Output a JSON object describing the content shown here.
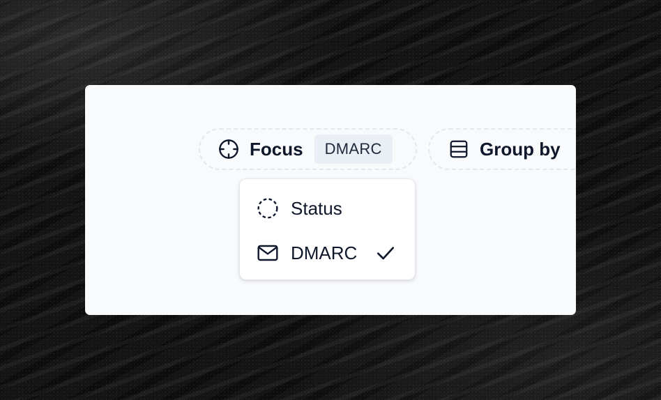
{
  "toolbar": {
    "focus": {
      "label": "Focus",
      "icon": "crosshair-icon",
      "selected_value": "DMARC"
    },
    "group_by": {
      "label": "Group by",
      "icon": "rows-icon"
    }
  },
  "focus_menu": {
    "items": [
      {
        "label": "Status",
        "icon": "dashed-circle-icon",
        "selected": false
      },
      {
        "label": "DMARC",
        "icon": "mail-icon",
        "selected": true
      }
    ]
  },
  "colors": {
    "panel_background": "#f8fafc",
    "text": "#0f172a",
    "badge_background": "#eaeef5",
    "chip_border": "#e3e8ee"
  }
}
